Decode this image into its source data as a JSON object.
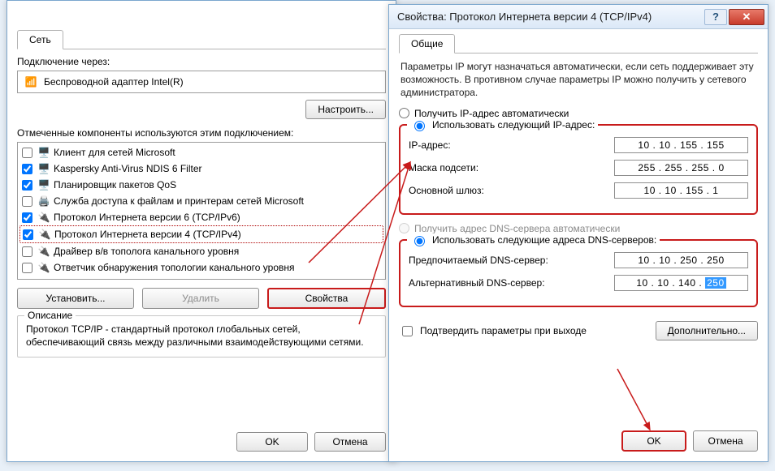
{
  "left": {
    "tab": "Сеть",
    "connect_label": "Подключение через:",
    "adapter": "Беспроводной адаптер Intel(R)",
    "configure_btn": "Настроить...",
    "components_label": "Отмеченные компоненты используются этим подключением:",
    "items": [
      {
        "chk": false,
        "label": "Клиент для сетей Microsoft"
      },
      {
        "chk": true,
        "label": "Kaspersky Anti-Virus NDIS 6 Filter"
      },
      {
        "chk": true,
        "label": "Планировщик пакетов QoS"
      },
      {
        "chk": false,
        "label": "Служба доступа к файлам и принтерам сетей Microsoft"
      },
      {
        "chk": true,
        "label": "Протокол Интернета версии 6 (TCP/IPv6)"
      },
      {
        "chk": true,
        "label": "Протокол Интернета версии 4 (TCP/IPv4)"
      },
      {
        "chk": false,
        "label": "Драйвер в/в тополога канального уровня"
      },
      {
        "chk": false,
        "label": "Ответчик обнаружения топологии канального уровня"
      }
    ],
    "install_btn": "Установить...",
    "remove_btn": "Удалить",
    "props_btn": "Свойства",
    "desc_title": "Описание",
    "desc_text": "Протокол TCP/IP - стандартный протокол глобальных сетей, обеспечивающий связь между различными взаимодействующими сетями.",
    "ok": "OK",
    "cancel": "Отмена"
  },
  "right": {
    "title": "Свойства: Протокол Интернета версии 4 (TCP/IPv4)",
    "tab": "Общие",
    "intro": "Параметры IP могут назначаться автоматически, если сеть поддерживает эту возможность. В противном случае параметры IP можно получить у сетевого администратора.",
    "ip_auto": "Получить IP-адрес автоматически",
    "ip_manual": "Использовать следующий IP-адрес:",
    "ip_label": "IP-адрес:",
    "ip_value": "10 . 10 . 155 . 155",
    "mask_label": "Маска подсети:",
    "mask_value": "255 . 255 . 255 .  0",
    "gw_label": "Основной шлюз:",
    "gw_value": "10 . 10 . 155 .  1",
    "dns_auto": "Получить адрес DNS-сервера автоматически",
    "dns_manual": "Использовать следующие адреса DNS-серверов:",
    "dns1_label": "Предпочитаемый DNS-сервер:",
    "dns1_value": "10 . 10 . 250 . 250",
    "dns2_label": "Альтернативный DNS-сервер:",
    "dns2_pre": "10 . 10 . 140 . ",
    "dns2_sel": "250",
    "confirm_exit": "Подтвердить параметры при выходе",
    "advanced": "Дополнительно...",
    "ok": "OK",
    "cancel": "Отмена"
  }
}
